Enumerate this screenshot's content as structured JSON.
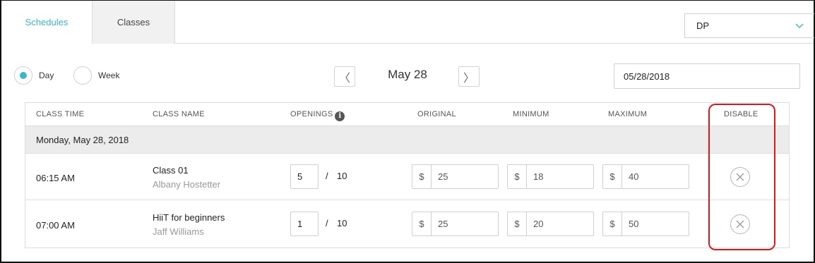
{
  "tabs": [
    {
      "label": "Schedules",
      "active": true
    },
    {
      "label": "Classes",
      "active": false
    }
  ],
  "location_select": {
    "value": "DP"
  },
  "view": {
    "day_label": "Day",
    "week_label": "Week",
    "selected": "Day"
  },
  "date_nav": {
    "prev_symbol": "〈",
    "next_symbol": "〉",
    "title": "May 28",
    "date_value": "05/28/2018"
  },
  "table": {
    "headers": {
      "class_time": "CLASS TIME",
      "class_name": "CLASS NAME",
      "openings": "OPENINGS",
      "original": "ORIGINAL",
      "minimum": "MINIMUM",
      "maximum": "MAXIMUM",
      "disable": "DISABLE"
    },
    "group_label": "Monday, May 28, 2018",
    "currency": "$",
    "separator": "/",
    "rows": [
      {
        "time": "06:15 AM",
        "name": "Class 01",
        "instructor": "Albany Hostetter",
        "openings": "5",
        "capacity": "10",
        "original": "25",
        "minimum": "18",
        "maximum": "40"
      },
      {
        "time": "07:00 AM",
        "name": "HiiT for beginners",
        "instructor": "Jaff Williams",
        "openings": "1",
        "capacity": "10",
        "original": "25",
        "minimum": "20",
        "maximum": "50"
      }
    ]
  },
  "colors": {
    "accent": "#3ab7c8",
    "highlight": "#e0151b"
  }
}
